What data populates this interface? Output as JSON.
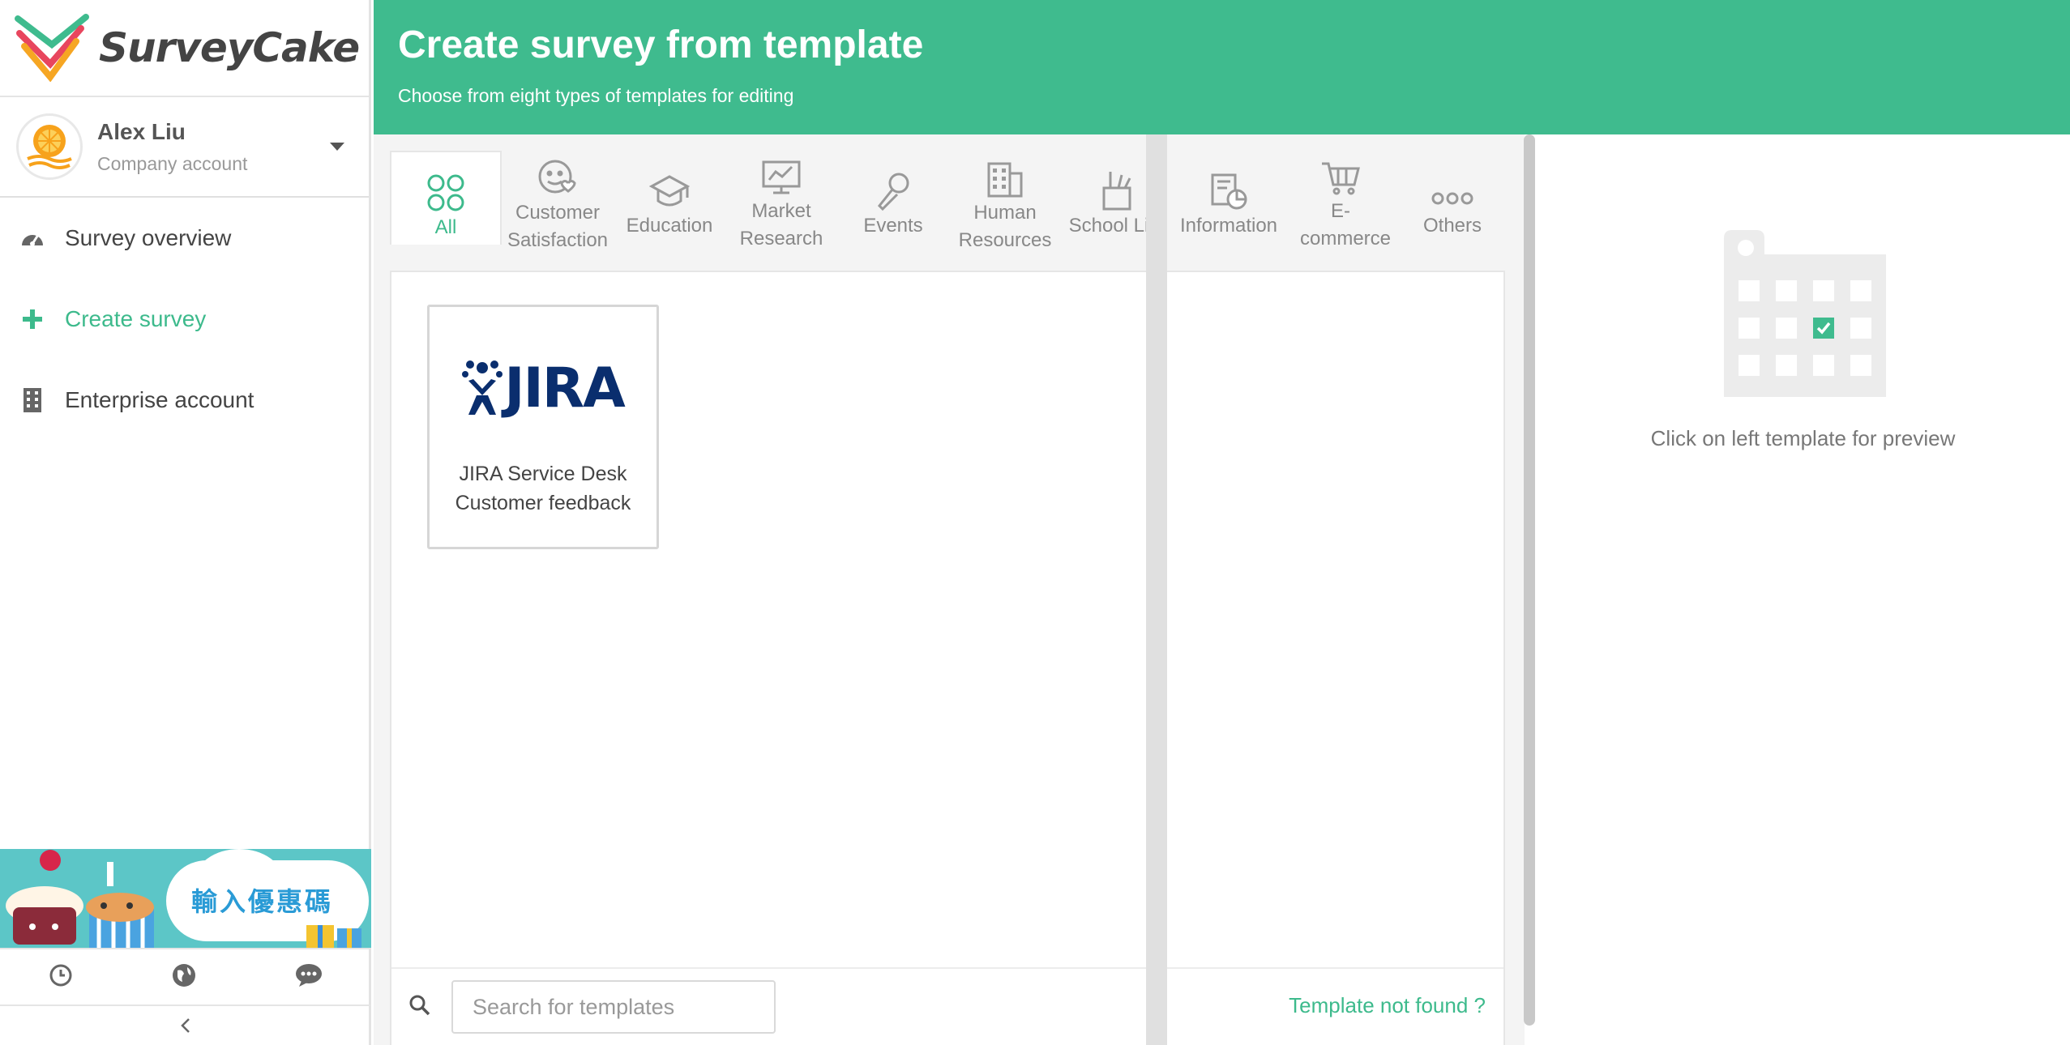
{
  "app": {
    "name": "SurveyCake"
  },
  "account": {
    "name": "Alex Liu",
    "type": "Company account"
  },
  "nav": [
    {
      "label": "Survey overview",
      "icon": "dashboard-icon"
    },
    {
      "label": "Create survey",
      "icon": "plus-icon",
      "active": true
    },
    {
      "label": "Enterprise account",
      "icon": "building-icon"
    }
  ],
  "banner": {
    "text": "輸入優惠碼"
  },
  "header": {
    "title": "Create survey from template",
    "subtitle": "Choose from eight types of templates for editing"
  },
  "tabs": [
    {
      "label": "All",
      "icon": "grid-icon",
      "active": true
    },
    {
      "label": "Customer Satisfaction",
      "icon": "smile-heart-icon"
    },
    {
      "label": "Education",
      "icon": "graduation-cap-icon"
    },
    {
      "label": "Market Research",
      "icon": "chart-monitor-icon"
    },
    {
      "label": "Events",
      "icon": "microphone-icon"
    },
    {
      "label": "Human Resources",
      "icon": "office-building-icon"
    },
    {
      "label": "School Life",
      "icon": "pencil-cup-icon"
    },
    {
      "label": "Information",
      "icon": "document-chart-icon"
    },
    {
      "label": "E-commerce",
      "icon": "cart-icon"
    },
    {
      "label": "Others",
      "icon": "dots-icon"
    }
  ],
  "templates": [
    {
      "logo_text": "JIRA",
      "title_line1": "JIRA Service Desk",
      "title_line2": "Customer feedback"
    }
  ],
  "search": {
    "placeholder": "Search for templates",
    "not_found": "Template not found ?"
  },
  "preview": {
    "text": "Click on left template for preview"
  },
  "colors": {
    "brand": "#3fbb8e",
    "jira": "#0a2e6e"
  }
}
